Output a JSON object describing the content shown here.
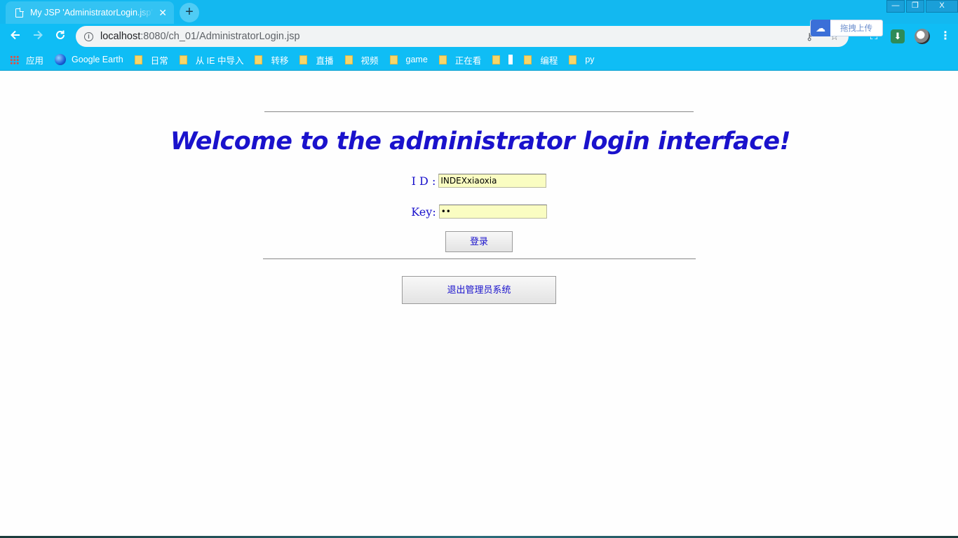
{
  "browser": {
    "tab_title": "My JSP 'AdministratorLogin.jsp' starting page",
    "tab_close": "✕",
    "new_tab": "+",
    "url_host": "localhost",
    "url_path": ":8080/ch_01/AdministratorLogin.jsp",
    "window_controls": {
      "minimize": "—",
      "restore": "❐",
      "close": "X"
    },
    "baidu_upload_label": "拖拽上传"
  },
  "bookmarks": [
    {
      "label": "应用",
      "icon": "apps-grid-icon"
    },
    {
      "label": "Google Earth",
      "icon": "google-earth-icon"
    },
    {
      "label": "日常",
      "icon": "folder-icon"
    },
    {
      "label": "从 IE 中导入",
      "icon": "folder-icon"
    },
    {
      "label": "转移",
      "icon": "folder-icon"
    },
    {
      "label": "直播",
      "icon": "folder-icon"
    },
    {
      "label": "视频",
      "icon": "folder-icon"
    },
    {
      "label": "game",
      "icon": "folder-icon"
    },
    {
      "label": "正在看",
      "icon": "folder-icon"
    },
    {
      "label": "",
      "icon": "folder-icon"
    },
    {
      "label": "编程",
      "icon": "folder-icon"
    },
    {
      "label": "py",
      "icon": "folder-icon"
    }
  ],
  "page": {
    "heading": "Welcome to the administrator login interface!",
    "id_label": "I D :",
    "id_value": "INDEXxiaoxia",
    "key_label": "Key:",
    "key_value": "••",
    "login_button": "登录",
    "exit_button": "退出管理员系统"
  },
  "colors": {
    "chrome": "#0fbdf5",
    "heading": "#1a12cc",
    "field_bg": "#fafdc2"
  }
}
